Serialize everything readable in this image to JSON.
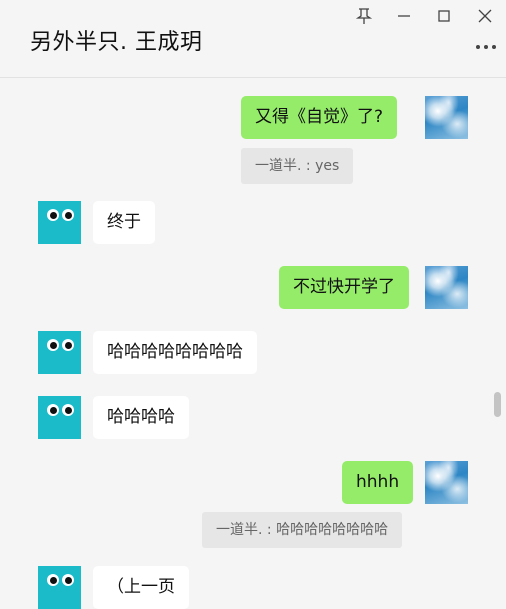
{
  "window": {
    "title": "另外半只. 王成玥",
    "controls": [
      "pin-icon",
      "minimize-icon",
      "maximize-icon",
      "close-icon"
    ],
    "more_icon": "more-icon"
  },
  "colors": {
    "outgoing_bubble": "#95ec69",
    "incoming_bubble": "#ffffff",
    "quote_bg": "#e6e6e6",
    "background": "#f5f5f5",
    "contact_avatar": "#1bbbc9"
  },
  "messages": [
    {
      "side": "out",
      "text": "又得《自觉》了?"
    },
    {
      "side": "out",
      "quote": "一道半. : yes"
    },
    {
      "side": "in",
      "text": "终于"
    },
    {
      "side": "out",
      "text": "不过快开学了"
    },
    {
      "side": "in",
      "text": "哈哈哈哈哈哈哈哈"
    },
    {
      "side": "in",
      "text": "哈哈哈哈"
    },
    {
      "side": "out",
      "text": "hhhh"
    },
    {
      "side": "out",
      "quote": "一道半. : 哈哈哈哈哈哈哈哈"
    },
    {
      "side": "in",
      "text": "（上一页"
    }
  ]
}
